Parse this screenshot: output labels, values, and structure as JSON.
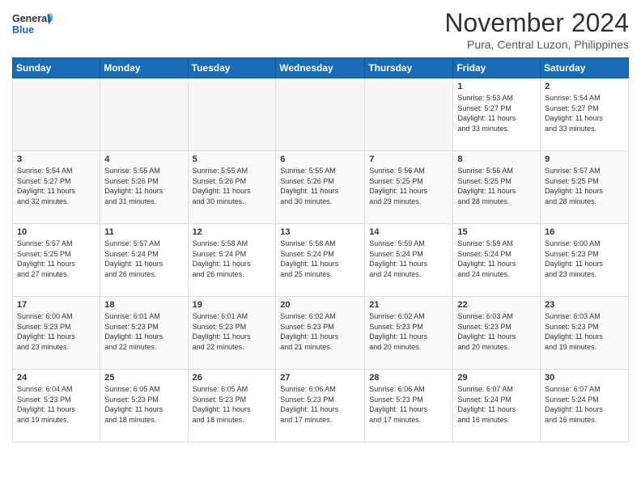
{
  "logo": {
    "line1": "General",
    "line2": "Blue"
  },
  "title": "November 2024",
  "location": "Pura, Central Luzon, Philippines",
  "weekdays": [
    "Sunday",
    "Monday",
    "Tuesday",
    "Wednesday",
    "Thursday",
    "Friday",
    "Saturday"
  ],
  "weeks": [
    [
      {
        "day": "",
        "info": ""
      },
      {
        "day": "",
        "info": ""
      },
      {
        "day": "",
        "info": ""
      },
      {
        "day": "",
        "info": ""
      },
      {
        "day": "",
        "info": ""
      },
      {
        "day": "1",
        "info": "Sunrise: 5:53 AM\nSunset: 5:27 PM\nDaylight: 11 hours\nand 33 minutes."
      },
      {
        "day": "2",
        "info": "Sunrise: 5:54 AM\nSunset: 5:27 PM\nDaylight: 11 hours\nand 33 minutes."
      }
    ],
    [
      {
        "day": "3",
        "info": "Sunrise: 5:54 AM\nSunset: 5:27 PM\nDaylight: 11 hours\nand 32 minutes."
      },
      {
        "day": "4",
        "info": "Sunrise: 5:55 AM\nSunset: 5:26 PM\nDaylight: 11 hours\nand 31 minutes."
      },
      {
        "day": "5",
        "info": "Sunrise: 5:55 AM\nSunset: 5:26 PM\nDaylight: 11 hours\nand 30 minutes."
      },
      {
        "day": "6",
        "info": "Sunrise: 5:55 AM\nSunset: 5:26 PM\nDaylight: 11 hours\nand 30 minutes."
      },
      {
        "day": "7",
        "info": "Sunrise: 5:56 AM\nSunset: 5:25 PM\nDaylight: 11 hours\nand 29 minutes."
      },
      {
        "day": "8",
        "info": "Sunrise: 5:56 AM\nSunset: 5:25 PM\nDaylight: 11 hours\nand 28 minutes."
      },
      {
        "day": "9",
        "info": "Sunrise: 5:57 AM\nSunset: 5:25 PM\nDaylight: 11 hours\nand 28 minutes."
      }
    ],
    [
      {
        "day": "10",
        "info": "Sunrise: 5:57 AM\nSunset: 5:25 PM\nDaylight: 11 hours\nand 27 minutes."
      },
      {
        "day": "11",
        "info": "Sunrise: 5:57 AM\nSunset: 5:24 PM\nDaylight: 11 hours\nand 26 minutes."
      },
      {
        "day": "12",
        "info": "Sunrise: 5:58 AM\nSunset: 5:24 PM\nDaylight: 11 hours\nand 26 minutes."
      },
      {
        "day": "13",
        "info": "Sunrise: 5:58 AM\nSunset: 5:24 PM\nDaylight: 11 hours\nand 25 minutes."
      },
      {
        "day": "14",
        "info": "Sunrise: 5:59 AM\nSunset: 5:24 PM\nDaylight: 11 hours\nand 24 minutes."
      },
      {
        "day": "15",
        "info": "Sunrise: 5:59 AM\nSunset: 5:24 PM\nDaylight: 11 hours\nand 24 minutes."
      },
      {
        "day": "16",
        "info": "Sunrise: 6:00 AM\nSunset: 5:23 PM\nDaylight: 11 hours\nand 23 minutes."
      }
    ],
    [
      {
        "day": "17",
        "info": "Sunrise: 6:00 AM\nSunset: 5:23 PM\nDaylight: 11 hours\nand 23 minutes."
      },
      {
        "day": "18",
        "info": "Sunrise: 6:01 AM\nSunset: 5:23 PM\nDaylight: 11 hours\nand 22 minutes."
      },
      {
        "day": "19",
        "info": "Sunrise: 6:01 AM\nSunset: 5:23 PM\nDaylight: 11 hours\nand 22 minutes."
      },
      {
        "day": "20",
        "info": "Sunrise: 6:02 AM\nSunset: 5:23 PM\nDaylight: 11 hours\nand 21 minutes."
      },
      {
        "day": "21",
        "info": "Sunrise: 6:02 AM\nSunset: 5:23 PM\nDaylight: 11 hours\nand 20 minutes."
      },
      {
        "day": "22",
        "info": "Sunrise: 6:03 AM\nSunset: 5:23 PM\nDaylight: 11 hours\nand 20 minutes."
      },
      {
        "day": "23",
        "info": "Sunrise: 6:03 AM\nSunset: 5:23 PM\nDaylight: 11 hours\nand 19 minutes."
      }
    ],
    [
      {
        "day": "24",
        "info": "Sunrise: 6:04 AM\nSunset: 5:23 PM\nDaylight: 11 hours\nand 19 minutes."
      },
      {
        "day": "25",
        "info": "Sunrise: 6:05 AM\nSunset: 5:23 PM\nDaylight: 11 hours\nand 18 minutes."
      },
      {
        "day": "26",
        "info": "Sunrise: 6:05 AM\nSunset: 5:23 PM\nDaylight: 11 hours\nand 18 minutes."
      },
      {
        "day": "27",
        "info": "Sunrise: 6:06 AM\nSunset: 5:23 PM\nDaylight: 11 hours\nand 17 minutes."
      },
      {
        "day": "28",
        "info": "Sunrise: 6:06 AM\nSunset: 5:23 PM\nDaylight: 11 hours\nand 17 minutes."
      },
      {
        "day": "29",
        "info": "Sunrise: 6:07 AM\nSunset: 5:24 PM\nDaylight: 11 hours\nand 16 minutes."
      },
      {
        "day": "30",
        "info": "Sunrise: 6:07 AM\nSunset: 5:24 PM\nDaylight: 11 hours\nand 16 minutes."
      }
    ]
  ]
}
